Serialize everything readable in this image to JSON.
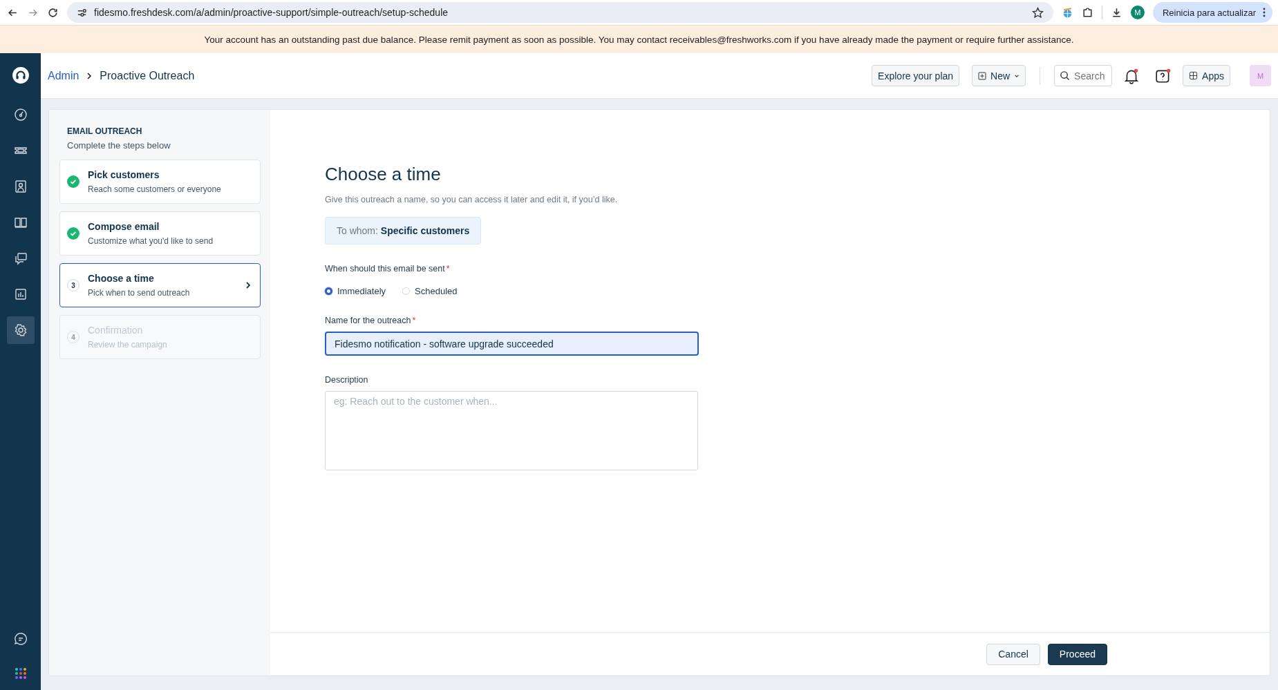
{
  "browser": {
    "url": "fidesmo.freshdesk.com/a/admin/proactive-support/simple-outreach/setup-schedule",
    "profile_initial": "M",
    "update_button": "Reinicia para actualizar"
  },
  "banner": {
    "text": "Your account has an outstanding past due balance. Please remit payment as soon as possible. You may contact receivables@freshworks.com if you have already made the payment or require further assistance."
  },
  "nav": {
    "items": [
      {
        "kind": "dashboard",
        "selected": false
      },
      {
        "kind": "ticket",
        "selected": false
      },
      {
        "kind": "contact",
        "selected": false
      },
      {
        "kind": "book",
        "selected": false
      },
      {
        "kind": "chat",
        "selected": false
      },
      {
        "kind": "report",
        "selected": false
      },
      {
        "kind": "settings",
        "selected": true
      }
    ]
  },
  "header": {
    "breadcrumb": {
      "parent": "Admin",
      "current": "Proactive Outreach"
    },
    "explore_button": "Explore your plan",
    "new_button": "New",
    "search": {
      "placeholder": "Search"
    },
    "apps_button": "Apps",
    "avatar_initial": "M"
  },
  "steps_panel": {
    "title": "EMAIL OUTREACH",
    "subtitle": "Complete the steps below",
    "steps": [
      {
        "kind": "done",
        "title": "Pick customers",
        "subtitle": "Reach some customers or everyone"
      },
      {
        "kind": "done",
        "title": "Compose email",
        "subtitle": "Customize what you'd like to send"
      },
      {
        "kind": "current",
        "number": "3",
        "title": "Choose a time",
        "subtitle": "Pick when to send outreach"
      },
      {
        "kind": "pending",
        "number": "4",
        "title": "Confirmation",
        "subtitle": "Review the campaign"
      }
    ]
  },
  "form": {
    "title": "Choose a time",
    "subtitle": "Give this outreach a name, so you can access it later and edit it, if you’d like.",
    "to_whom": {
      "label": "To whom:",
      "value": "Specific customers"
    },
    "send_when": {
      "label": "When should this email be sent",
      "required_mark": "*",
      "options": [
        {
          "label": "Immediately",
          "selected": true
        },
        {
          "label": "Scheduled",
          "selected": false
        }
      ]
    },
    "name_field": {
      "label": "Name for the outreach",
      "required_mark": "*",
      "value": "Fidesmo notification - software upgrade succeeded"
    },
    "description": {
      "label": "Description",
      "placeholder": "eg: Reach out to the customer when..."
    }
  },
  "footer": {
    "cancel_button": "Cancel",
    "proceed_button": "Proceed"
  }
}
